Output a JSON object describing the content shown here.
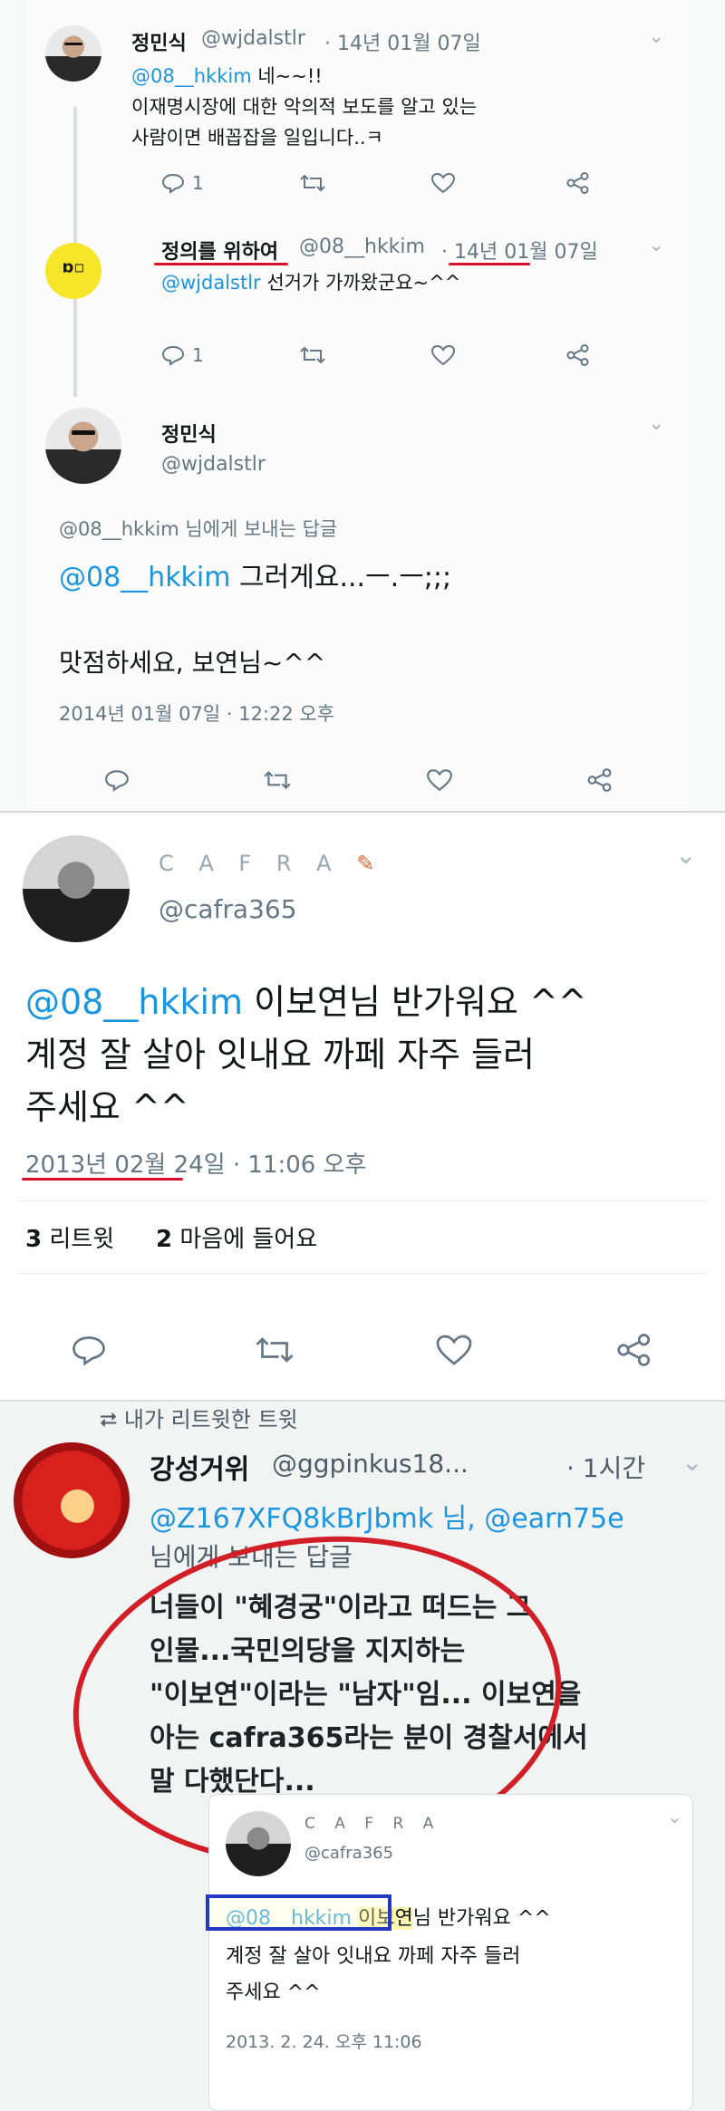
{
  "panel1": {
    "reply1": {
      "name": "정민식",
      "handle": "@wjdalstlr",
      "date": "14년 01월 07일",
      "mention": "@08__hkkim",
      "text_after_mention": "네~~!!",
      "lines": [
        "이재명시장에 대한 악의적 보도를 알고 있는",
        "사람이면 배꼽잡을 일입니다..ㅋ"
      ],
      "reply_count": "1"
    },
    "reply2": {
      "name": "정의를 위하여",
      "handle": "@08__hkkim",
      "date": "14년 01월 07일",
      "mention": "@wjdalstlr",
      "text": "선거가 가까왔군요~^^",
      "reply_count": "1",
      "avatar_glyph": "ɒ▫"
    },
    "main": {
      "name": "정민식",
      "handle": "@wjdalstlr",
      "reply_to": "@08__hkkim 님에게 보내는 답글",
      "mention": "@08__hkkim",
      "line1_rest": "그러게요...ㅡ.ㅡ;;;",
      "line2": "맛점하세요, 보연님~^^",
      "timestamp": "2014년 01월 07일 · 12:22 오후"
    }
  },
  "panel2": {
    "name": "C A F R A",
    "name_deco": "✎",
    "handle": "@cafra365",
    "mention": "@08__hkkim",
    "line1_rest": "이보연님 반가워요 ^^",
    "line2": "계정 잘 살아 잇내요 까페 자주 들러",
    "line3": "주세요 ^^",
    "timestamp": "2013년 02월 24일 · 11:06 오후",
    "retweets_count": "3",
    "retweets_label": "리트윗",
    "likes_count": "2",
    "likes_label": "마음에 들어요"
  },
  "panel3": {
    "retweet_banner": "내가 리트윗한 트윗",
    "name": "강성거위",
    "handle": "@ggpinkus18...",
    "time": "· 1시간",
    "mentions_line": "@Z167XFQ8kBrJbmk 님, @earn75e",
    "mentions_line2": "님에게 보내는 답글",
    "body": [
      "너들이 \"혜경궁\"이라고 떠드는 그",
      "인물...국민의당을 지지하는",
      "\"이보연\"이라는 \"남자\"임... 이보연을",
      "아는 cafra365라는 분이 경찰서에서",
      "말 다했단다..."
    ],
    "quote": {
      "name": "C A F R A",
      "handle": "@cafra365",
      "mention": "@08__hkkim",
      "highlight": "이보연",
      "line1_rest": "님 반가워요 ^^",
      "line2": "계정 잘 살아 잇내요 까페 자주 들러",
      "line3": "주세요 ^^",
      "timestamp": "2013. 2. 24. 오후 11:06"
    }
  },
  "colors": {
    "link": "#1b95e0",
    "annotation_red": "#d21f27",
    "annotation_blue": "#2338c4",
    "muted": "#657786"
  },
  "icons": [
    "reply-icon",
    "retweet-icon",
    "like-icon",
    "share-icon",
    "chevron-down-icon"
  ]
}
